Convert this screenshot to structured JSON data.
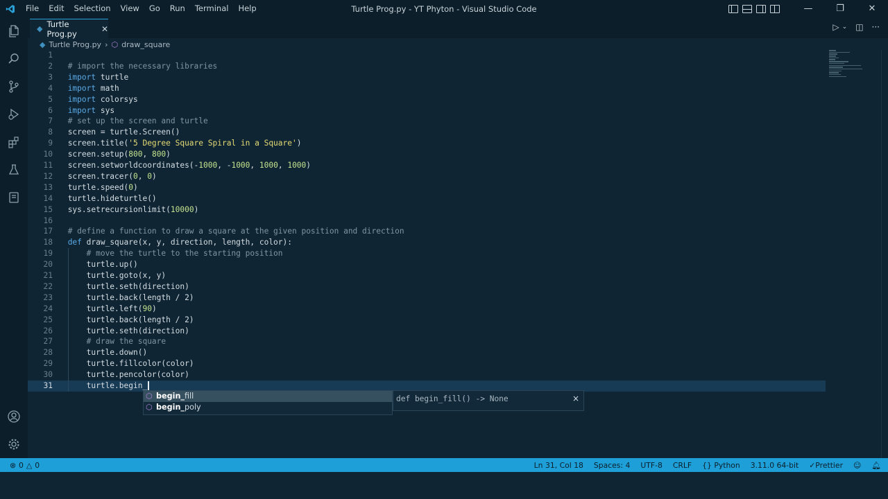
{
  "titlebar": {
    "menu": [
      "File",
      "Edit",
      "Selection",
      "View",
      "Go",
      "Run",
      "Terminal",
      "Help"
    ],
    "window_title": "Turtle Prog.py - YT Phyton - Visual Studio Code"
  },
  "tabs": [
    {
      "label": "Turtle Prog.py"
    }
  ],
  "breadcrumb": {
    "file": "Turtle Prog.py",
    "symbol": "draw_square"
  },
  "editor": {
    "lines": [
      {
        "n": "1",
        "code": ""
      },
      {
        "n": "2",
        "code": "# import the necessary libraries"
      },
      {
        "n": "3",
        "code": "import turtle"
      },
      {
        "n": "4",
        "code": "import math"
      },
      {
        "n": "5",
        "code": "import colorsys"
      },
      {
        "n": "6",
        "code": "import sys"
      },
      {
        "n": "7",
        "code": "# set up the screen and turtle"
      },
      {
        "n": "8",
        "code": "screen = turtle.Screen()"
      },
      {
        "n": "9",
        "code": "screen.title('5 Degree Square Spiral in a Square')"
      },
      {
        "n": "10",
        "code": "screen.setup(800, 800)"
      },
      {
        "n": "11",
        "code": "screen.setworldcoordinates(-1000, -1000, 1000, 1000)"
      },
      {
        "n": "12",
        "code": "screen.tracer(0, 0)"
      },
      {
        "n": "13",
        "code": "turtle.speed(0)"
      },
      {
        "n": "14",
        "code": "turtle.hideturtle()"
      },
      {
        "n": "15",
        "code": "sys.setrecursionlimit(10000)"
      },
      {
        "n": "16",
        "code": ""
      },
      {
        "n": "17",
        "code": "# define a function to draw a square at the given position and direction"
      },
      {
        "n": "18",
        "code": "def draw_square(x, y, direction, length, color):"
      },
      {
        "n": "19",
        "code": "    # move the turtle to the starting position"
      },
      {
        "n": "20",
        "code": "    turtle.up()"
      },
      {
        "n": "21",
        "code": "    turtle.goto(x, y)"
      },
      {
        "n": "22",
        "code": "    turtle.seth(direction)"
      },
      {
        "n": "23",
        "code": "    turtle.back(length / 2)"
      },
      {
        "n": "24",
        "code": "    turtle.left(90)"
      },
      {
        "n": "25",
        "code": "    turtle.back(length / 2)"
      },
      {
        "n": "26",
        "code": "    turtle.seth(direction)"
      },
      {
        "n": "27",
        "code": "    # draw the square"
      },
      {
        "n": "28",
        "code": "    turtle.down()"
      },
      {
        "n": "29",
        "code": "    turtle.fillcolor(color)"
      },
      {
        "n": "30",
        "code": "    turtle.pencolor(color)"
      },
      {
        "n": "31",
        "code": "    turtle.begin_"
      }
    ]
  },
  "suggest": {
    "items": [
      {
        "match": "begin_",
        "rest": "fill"
      },
      {
        "match": "begin_",
        "rest": "poly"
      }
    ],
    "detail": "def begin_fill() -> None",
    "close": "×"
  },
  "statusbar": {
    "errors": "0",
    "warnings": "0",
    "position": "Ln 31, Col 18",
    "spaces": "Spaces: 4",
    "encoding": "UTF-8",
    "eol": "CRLF",
    "language": "Python",
    "interpreter": "3.11.0 64-bit",
    "formatter": "Prettier"
  },
  "colors": {
    "accent": "#1f9fd8",
    "background": "#0f2533",
    "chrome": "#0b1e29"
  }
}
